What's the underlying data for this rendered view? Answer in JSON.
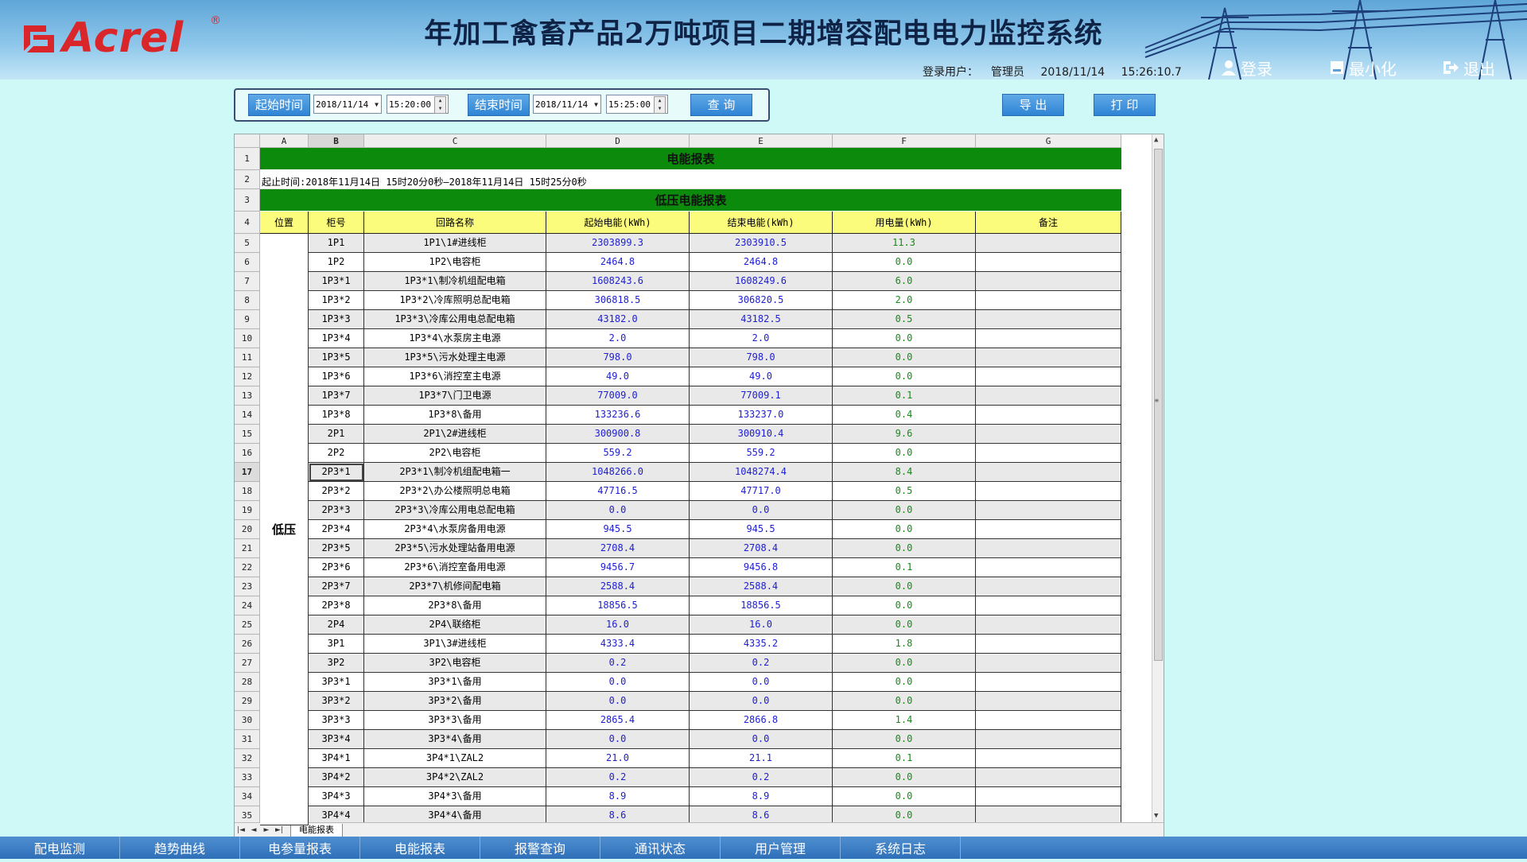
{
  "header": {
    "logo_text": "Acrel",
    "logo_reg": "®",
    "title": "年加工禽畜产品2万吨项目二期增容配电电力监控系统",
    "login_label": "登录用户：",
    "user": "管理员",
    "date": "2018/11/14",
    "time": "15:26:10.7",
    "login_btn": "登录",
    "minimize_btn": "最小化",
    "exit_btn": "退出"
  },
  "toolbar": {
    "start_label": "起始时间",
    "start_date": "2018/11/14",
    "start_time": "15:20:00",
    "end_label": "结束时间",
    "end_date": "2018/11/14",
    "end_time": "15:25:00",
    "query_btn": "查 询",
    "export_btn": "导 出",
    "print_btn": "打 印"
  },
  "sheet": {
    "columns": [
      "A",
      "B",
      "C",
      "D",
      "E",
      "F",
      "G"
    ],
    "selected_column": "B",
    "selected_row": "17",
    "title": "电能报表",
    "range_text": "起止时间:2018年11月14日 15时20分0秒—2018年11月14日 15时25分0秒",
    "subtitle": "低压电能报表",
    "headers": [
      "位置",
      "柜号",
      "回路名称",
      "起始电能(kWh)",
      "结束电能(kWh)",
      "用电量(kWh)",
      "备注"
    ],
    "location": "低压",
    "rows": [
      {
        "n": "5",
        "cab": "1P1",
        "name": "1P1\\1#进线柜",
        "start": "2303899.3",
        "end": "2303910.5",
        "use": "11.3"
      },
      {
        "n": "6",
        "cab": "1P2",
        "name": "1P2\\电容柜",
        "start": "2464.8",
        "end": "2464.8",
        "use": "0.0"
      },
      {
        "n": "7",
        "cab": "1P3*1",
        "name": "1P3*1\\制冷机组配电箱",
        "start": "1608243.6",
        "end": "1608249.6",
        "use": "6.0"
      },
      {
        "n": "8",
        "cab": "1P3*2",
        "name": "1P3*2\\冷库照明总配电箱",
        "start": "306818.5",
        "end": "306820.5",
        "use": "2.0"
      },
      {
        "n": "9",
        "cab": "1P3*3",
        "name": "1P3*3\\冷库公用电总配电箱",
        "start": "43182.0",
        "end": "43182.5",
        "use": "0.5"
      },
      {
        "n": "10",
        "cab": "1P3*4",
        "name": "1P3*4\\水泵房主电源",
        "start": "2.0",
        "end": "2.0",
        "use": "0.0"
      },
      {
        "n": "11",
        "cab": "1P3*5",
        "name": "1P3*5\\污水处理主电源",
        "start": "798.0",
        "end": "798.0",
        "use": "0.0"
      },
      {
        "n": "12",
        "cab": "1P3*6",
        "name": "1P3*6\\消控室主电源",
        "start": "49.0",
        "end": "49.0",
        "use": "0.0"
      },
      {
        "n": "13",
        "cab": "1P3*7",
        "name": "1P3*7\\门卫电源",
        "start": "77009.0",
        "end": "77009.1",
        "use": "0.1"
      },
      {
        "n": "14",
        "cab": "1P3*8",
        "name": "1P3*8\\备用",
        "start": "133236.6",
        "end": "133237.0",
        "use": "0.4"
      },
      {
        "n": "15",
        "cab": "2P1",
        "name": "2P1\\2#进线柜",
        "start": "300900.8",
        "end": "300910.4",
        "use": "9.6"
      },
      {
        "n": "16",
        "cab": "2P2",
        "name": "2P2\\电容柜",
        "start": "559.2",
        "end": "559.2",
        "use": "0.0"
      },
      {
        "n": "17",
        "cab": "2P3*1",
        "name": "2P3*1\\制冷机组配电箱一",
        "start": "1048266.0",
        "end": "1048274.4",
        "use": "8.4"
      },
      {
        "n": "18",
        "cab": "2P3*2",
        "name": "2P3*2\\办公楼照明总电箱",
        "start": "47716.5",
        "end": "47717.0",
        "use": "0.5"
      },
      {
        "n": "19",
        "cab": "2P3*3",
        "name": "2P3*3\\冷库公用电总配电箱",
        "start": "0.0",
        "end": "0.0",
        "use": "0.0"
      },
      {
        "n": "20",
        "cab": "2P3*4",
        "name": "2P3*4\\水泵房备用电源",
        "start": "945.5",
        "end": "945.5",
        "use": "0.0"
      },
      {
        "n": "21",
        "cab": "2P3*5",
        "name": "2P3*5\\污水处理站备用电源",
        "start": "2708.4",
        "end": "2708.4",
        "use": "0.0"
      },
      {
        "n": "22",
        "cab": "2P3*6",
        "name": "2P3*6\\消控室备用电源",
        "start": "9456.7",
        "end": "9456.8",
        "use": "0.1"
      },
      {
        "n": "23",
        "cab": "2P3*7",
        "name": "2P3*7\\机修间配电箱",
        "start": "2588.4",
        "end": "2588.4",
        "use": "0.0"
      },
      {
        "n": "24",
        "cab": "2P3*8",
        "name": "2P3*8\\备用",
        "start": "18856.5",
        "end": "18856.5",
        "use": "0.0"
      },
      {
        "n": "25",
        "cab": "2P4",
        "name": "2P4\\联络柜",
        "start": "16.0",
        "end": "16.0",
        "use": "0.0"
      },
      {
        "n": "26",
        "cab": "3P1",
        "name": "3P1\\3#进线柜",
        "start": "4333.4",
        "end": "4335.2",
        "use": "1.8"
      },
      {
        "n": "27",
        "cab": "3P2",
        "name": "3P2\\电容柜",
        "start": "0.2",
        "end": "0.2",
        "use": "0.0"
      },
      {
        "n": "28",
        "cab": "3P3*1",
        "name": "3P3*1\\备用",
        "start": "0.0",
        "end": "0.0",
        "use": "0.0"
      },
      {
        "n": "29",
        "cab": "3P3*2",
        "name": "3P3*2\\备用",
        "start": "0.0",
        "end": "0.0",
        "use": "0.0"
      },
      {
        "n": "30",
        "cab": "3P3*3",
        "name": "3P3*3\\备用",
        "start": "2865.4",
        "end": "2866.8",
        "use": "1.4"
      },
      {
        "n": "31",
        "cab": "3P3*4",
        "name": "3P3*4\\备用",
        "start": "0.0",
        "end": "0.0",
        "use": "0.0"
      },
      {
        "n": "32",
        "cab": "3P4*1",
        "name": "3P4*1\\ZAL2",
        "start": "21.0",
        "end": "21.1",
        "use": "0.1"
      },
      {
        "n": "33",
        "cab": "3P4*2",
        "name": "3P4*2\\ZAL2",
        "start": "0.2",
        "end": "0.2",
        "use": "0.0"
      },
      {
        "n": "34",
        "cab": "3P4*3",
        "name": "3P4*3\\备用",
        "start": "8.9",
        "end": "8.9",
        "use": "0.0"
      },
      {
        "n": "35",
        "cab": "3P4*4",
        "name": "3P4*4\\备用",
        "start": "8.6",
        "end": "8.6",
        "use": "0.0"
      }
    ],
    "sheet_tab": "电能报表"
  },
  "nav": [
    "配电监测",
    "趋势曲线",
    "电参量报表",
    "电能报表",
    "报警查询",
    "通讯状态",
    "用户管理",
    "系统日志"
  ],
  "colors": {
    "background": "#cff9f6",
    "title_band": "#0b8a0b",
    "header_row": "#fbfb7c",
    "value_blue": "#1e1ed2",
    "value_green": "#188a18",
    "nav": "#2f6fb8",
    "logo_red": "#d9262b"
  }
}
